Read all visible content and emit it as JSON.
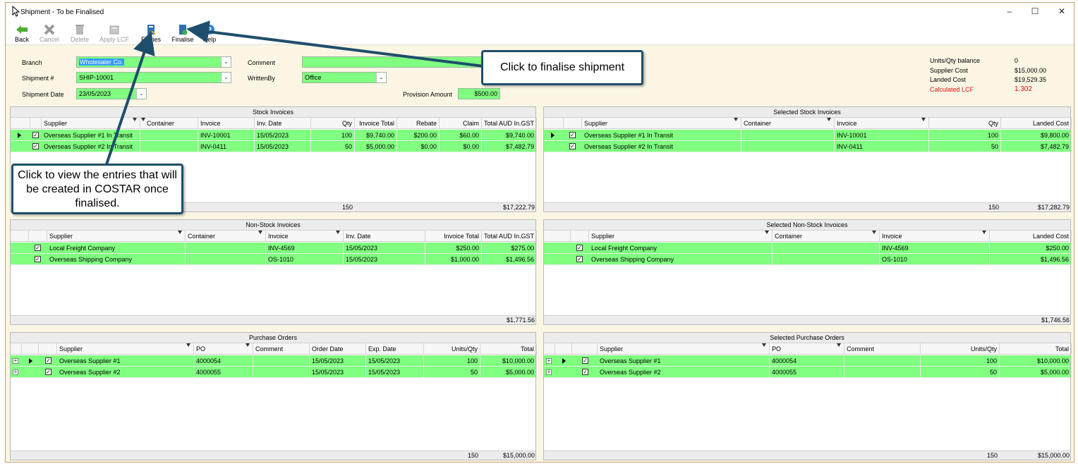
{
  "window": {
    "title": "Shipment - To be Finalised"
  },
  "toolbar": {
    "back": "Back",
    "cancel": "Cancel",
    "delete": "Delete",
    "apply_lcf": "Apply LCF",
    "entries": "Entries",
    "finalise": "Finalise",
    "help": "Help"
  },
  "form": {
    "branch_label": "Branch",
    "branch_value": "Wholesaler Co.",
    "shipment_no_label": "Shipment #",
    "shipment_no_value": "SHIP-10001",
    "shipment_date_label": "Shipment Date",
    "shipment_date_value": "23/05/2023",
    "comment_label": "Comment",
    "comment_value": "",
    "writtenby_label": "WrittenBy",
    "writtenby_value": "Office",
    "provision_label": "Provision Amount",
    "provision_value": "$500.00"
  },
  "summary": {
    "units_label": "Units/Qty balance",
    "units_value": "0",
    "supplier_cost_label": "Supplier Cost",
    "supplier_cost_value": "$15,000.00",
    "landed_cost_label": "Landed Cost",
    "landed_cost_value": "$19,529.35",
    "lcf_label": "Calculated LCF",
    "lcf_value": "1.302",
    "lcf_color": "#e01010"
  },
  "stock": {
    "title": "Stock Invoices",
    "headers": [
      "Supplier",
      "Container",
      "Invoice",
      "Inv. Date",
      "Qty",
      "Invoice Total",
      "Rebate",
      "Claim",
      "Total AUD In.GST"
    ],
    "rows": [
      [
        "Overseas Supplier #1 In Transit",
        "",
        "INV-10001",
        "15/05/2023",
        "100",
        "$9,740.00",
        "$200.00",
        "$60.00",
        "$9,740.00"
      ],
      [
        "Overseas Supplier #2 In Transit",
        "",
        "INV-0411",
        "15/05/2023",
        "50",
        "$5,000.00",
        "$0.00",
        "$0.00",
        "$7,482.79"
      ]
    ],
    "footer_qty": "150",
    "footer_total": "$17,222.79"
  },
  "sel_stock": {
    "title": "Selected Stock Invoices",
    "headers": [
      "Supplier",
      "Container",
      "Invoice",
      "Qty",
      "Landed Cost"
    ],
    "rows": [
      [
        "Overseas Supplier #1 In Transit",
        "",
        "INV-10001",
        "100",
        "$9,800.00"
      ],
      [
        "Overseas Supplier #2 In Transit",
        "",
        "INV-0411",
        "50",
        "$7,482.79"
      ]
    ],
    "footer_qty": "150",
    "footer_total": "$17,282.79"
  },
  "nonstock": {
    "title": "Non-Stock Invoices",
    "headers": [
      "Supplier",
      "Container",
      "Invoice",
      "Inv. Date",
      "Invoice Total",
      "Total AUD In.GST"
    ],
    "rows": [
      [
        "Local Freight Company",
        "",
        "INV-4569",
        "15/05/2023",
        "$250.00",
        "$275.00"
      ],
      [
        "Overseas Shipping Company",
        "",
        "OS-1010",
        "15/05/2023",
        "$1,000.00",
        "$1,496.56"
      ]
    ],
    "footer_total": "$1,771.56"
  },
  "sel_nonstock": {
    "title": "Selected Non-Stock Invoices",
    "headers": [
      "Supplier",
      "Container",
      "Invoice",
      "Landed Cost"
    ],
    "rows": [
      [
        "Local Freight Company",
        "",
        "INV-4569",
        "$250.00"
      ],
      [
        "Overseas Shipping Company",
        "",
        "OS-1010",
        "$1,496.56"
      ]
    ],
    "footer_total": "$1,746.56"
  },
  "po": {
    "title": "Purchase Orders",
    "headers": [
      "Supplier",
      "PO",
      "Comment",
      "Order Date",
      "Exp. Date",
      "Units/Qty",
      "Total"
    ],
    "rows": [
      [
        "Overseas Supplier #1",
        "4000054",
        "",
        "15/05/2023",
        "15/05/2023",
        "100",
        "$10,000.00"
      ],
      [
        "Overseas Supplier #2",
        "4000055",
        "",
        "15/05/2023",
        "15/05/2023",
        "50",
        "$5,000.00"
      ]
    ],
    "footer_qty": "150",
    "footer_total": "$15,000.00"
  },
  "sel_po": {
    "title": "Selected Purchase Orders",
    "headers": [
      "Supplier",
      "PO",
      "Comment",
      "Units/Qty",
      "Total"
    ],
    "rows": [
      [
        "Overseas Supplier #1",
        "4000054",
        "",
        "100",
        "$10,000.00"
      ],
      [
        "Overseas Supplier #2",
        "4000055",
        "",
        "50",
        "$5,000.00"
      ]
    ],
    "footer_qty": "150",
    "footer_total": "$15,000.00"
  },
  "callouts": {
    "finalise": "Click to finalise shipment",
    "entries": "Click to view the entries that will be created in COSTAR once finalised."
  },
  "colors": {
    "row_green": "#80ff80",
    "callout_border": "#1f4e6b",
    "arrow": "#1f4e6b"
  }
}
